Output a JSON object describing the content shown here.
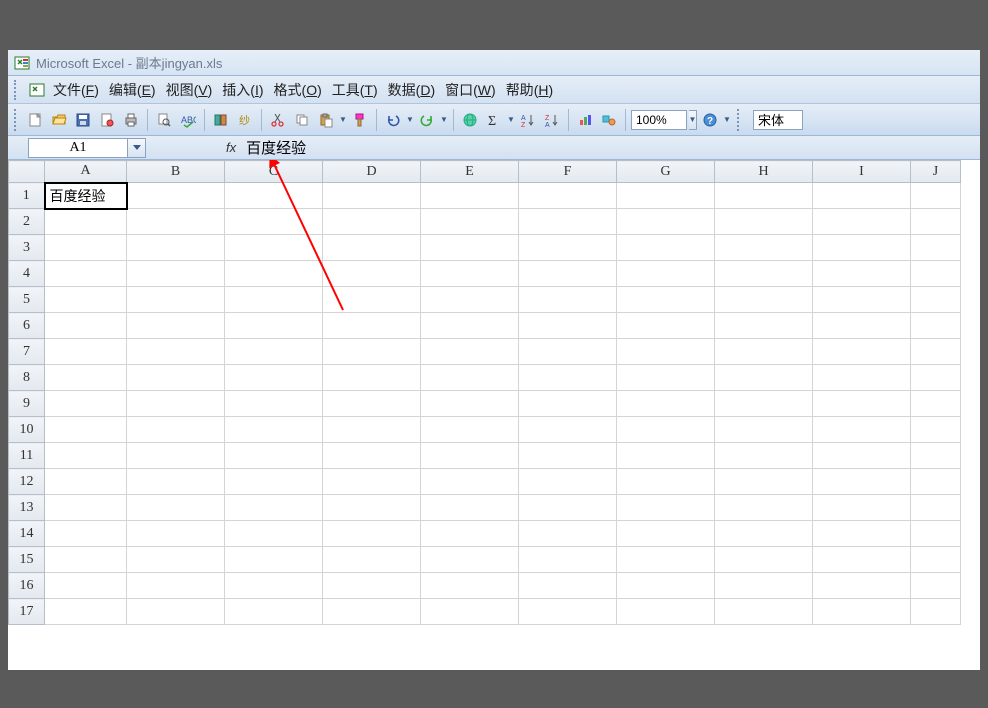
{
  "title": "Microsoft Excel - 副本jingyan.xls",
  "menu": {
    "file": {
      "label": "文件",
      "key": "F"
    },
    "edit": {
      "label": "编辑",
      "key": "E"
    },
    "view": {
      "label": "视图",
      "key": "V"
    },
    "insert": {
      "label": "插入",
      "key": "I"
    },
    "format": {
      "label": "格式",
      "key": "O"
    },
    "tools": {
      "label": "工具",
      "key": "T"
    },
    "data": {
      "label": "数据",
      "key": "D"
    },
    "window": {
      "label": "窗口",
      "key": "W"
    },
    "help": {
      "label": "帮助",
      "key": "H"
    }
  },
  "toolbar": {
    "zoom": "100%",
    "font": "宋体"
  },
  "formula": {
    "namebox": "A1",
    "fx": "fx",
    "value": "百度经验"
  },
  "columns": [
    "A",
    "B",
    "C",
    "D",
    "E",
    "F",
    "G",
    "H",
    "I",
    "J"
  ],
  "rowcount": 17,
  "cells": {
    "A1": "百度经验"
  },
  "active_cell": "A1"
}
